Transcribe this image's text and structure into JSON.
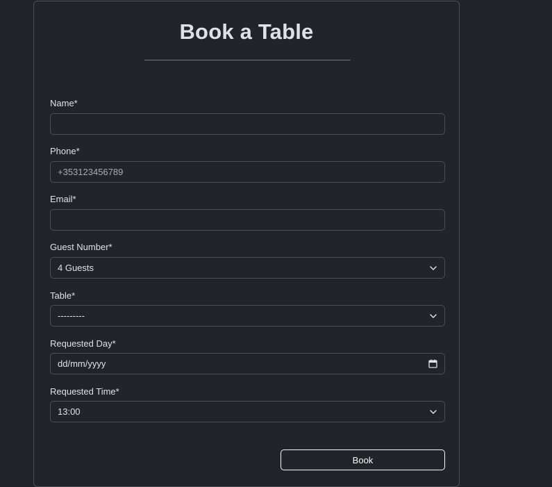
{
  "form": {
    "title": "Book a Table",
    "fields": {
      "name": {
        "label": "Name*",
        "value": "",
        "placeholder": ""
      },
      "phone": {
        "label": "Phone*",
        "value": "",
        "placeholder": "+353123456789"
      },
      "email": {
        "label": "Email*",
        "value": "",
        "placeholder": ""
      },
      "guest_number": {
        "label": "Guest Number*",
        "selected": "4 Guests"
      },
      "table": {
        "label": "Table*",
        "selected": "---------"
      },
      "requested_day": {
        "label": "Requested Day*",
        "value": "dd/mm/yyyy"
      },
      "requested_time": {
        "label": "Requested Time*",
        "selected": "13:00"
      }
    },
    "submit_label": "Book"
  },
  "colors": {
    "background": "#212529",
    "border": "#495057",
    "text": "#dee2e6",
    "button_border": "#f8f9fa"
  },
  "icons": {
    "select_arrow": "chevron-down-icon",
    "date_picker": "calendar-icon"
  }
}
